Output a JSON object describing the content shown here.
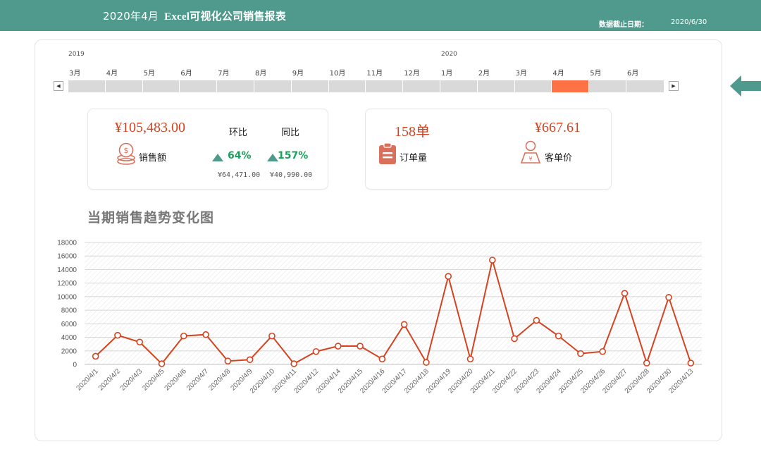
{
  "header": {
    "period": "2020年4月",
    "report_title": "Excel可视化公司销售报表",
    "data_date_label": "数据截止日期：",
    "data_date_value": "2020/6/30"
  },
  "timeline": {
    "years": [
      "2019",
      "2020"
    ],
    "months": [
      "3月",
      "4月",
      "5月",
      "6月",
      "7月",
      "8月",
      "9月",
      "10月",
      "11月",
      "12月",
      "1月",
      "2月",
      "3月",
      "4月",
      "5月",
      "6月"
    ],
    "selected_index": 13,
    "scroll_left": "◀",
    "scroll_right": "▶"
  },
  "sales_card": {
    "amount": "¥105,483.00",
    "label": "销售额",
    "mom_label": "环比",
    "yoy_label": "同比",
    "mom_pct": "64%",
    "yoy_pct": "157%",
    "mom_value": "¥64,471.00",
    "yoy_value": "¥40,990.00",
    "accent": "#d3431f",
    "up_color": "#4f9a8c"
  },
  "orders_card": {
    "orders": "158单",
    "orders_label": "订单量",
    "avg_price": "¥667.61",
    "avg_label": "客单价"
  },
  "chart_title": "当期销售趋势变化图",
  "chart_data": {
    "type": "line",
    "x": [
      "2020/4/1",
      "2020/4/2",
      "2020/4/3",
      "2020/4/5",
      "2020/4/6",
      "2020/4/7",
      "2020/4/8",
      "2020/4/9",
      "2020/4/10",
      "2020/4/11",
      "2020/4/12",
      "2020/4/14",
      "2020/4/15",
      "2020/4/16",
      "2020/4/17",
      "2020/4/18",
      "2020/4/19",
      "2020/4/20",
      "2020/4/21",
      "2020/4/22",
      "2020/4/23",
      "2020/4/24",
      "2020/4/25",
      "2020/4/26",
      "2020/4/27",
      "2020/4/28",
      "2020/4/30",
      "2020/4/13"
    ],
    "values": [
      1200,
      4300,
      3300,
      100,
      4200,
      4400,
      500,
      700,
      4200,
      100,
      1900,
      2700,
      2700,
      800,
      5900,
      300,
      13000,
      800,
      15400,
      3800,
      6500,
      4200,
      1600,
      1900,
      10500,
      200,
      9900,
      200
    ],
    "yticks": [
      0,
      2000,
      4000,
      6000,
      8000,
      10000,
      12000,
      14000,
      16000,
      18000
    ],
    "ylim": [
      0,
      18000
    ],
    "line_color": "#d3431f",
    "grid": true
  }
}
